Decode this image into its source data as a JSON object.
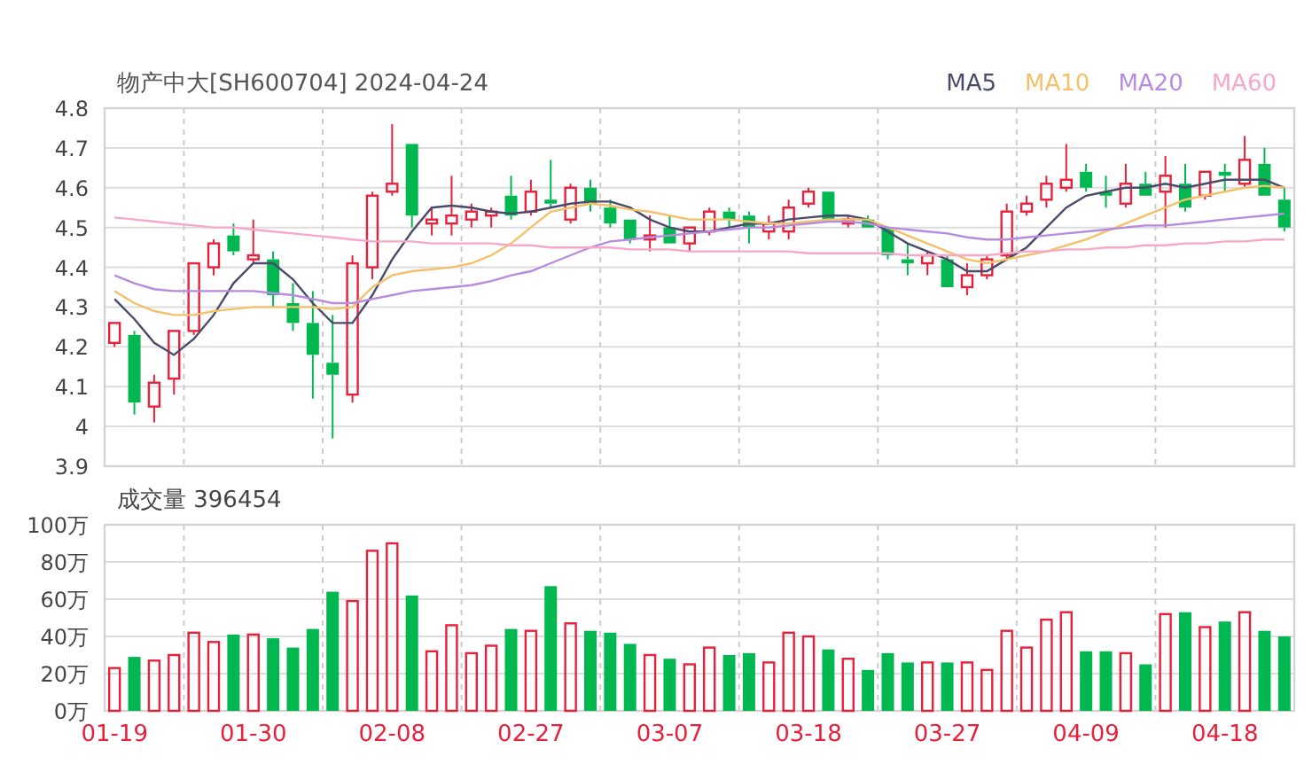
{
  "price_chart": {
    "candles": {
      "chart_data": {
        "type": "candlestick",
        "title": "物产中大[SH600704] 2024-04-24",
        "grid": true,
        "ylim": [
          3.9,
          4.8
        ],
        "yticks": [
          3.9,
          4,
          4.1,
          4.2,
          4.3,
          4.4,
          4.5,
          4.6,
          4.7,
          4.8
        ],
        "ohlc": [
          [
            4.21,
            4.26,
            4.2,
            4.26
          ],
          [
            4.23,
            4.24,
            4.03,
            4.06
          ],
          [
            4.05,
            4.13,
            4.01,
            4.11
          ],
          [
            4.12,
            4.24,
            4.08,
            4.24
          ],
          [
            4.24,
            4.41,
            4.23,
            4.41
          ],
          [
            4.4,
            4.47,
            4.38,
            4.46
          ],
          [
            4.48,
            4.51,
            4.43,
            4.44
          ],
          [
            4.42,
            4.52,
            4.41,
            4.43
          ],
          [
            4.42,
            4.44,
            4.3,
            4.33
          ],
          [
            4.31,
            4.36,
            4.24,
            4.26
          ],
          [
            4.26,
            4.34,
            4.07,
            4.18
          ],
          [
            4.16,
            4.28,
            3.97,
            4.13
          ],
          [
            4.08,
            4.43,
            4.06,
            4.41
          ],
          [
            4.4,
            4.59,
            4.37,
            4.58
          ],
          [
            4.59,
            4.76,
            4.58,
            4.61
          ],
          [
            4.71,
            4.71,
            4.5,
            4.53
          ],
          [
            4.51,
            4.55,
            4.48,
            4.52
          ],
          [
            4.51,
            4.63,
            4.48,
            4.53
          ],
          [
            4.52,
            4.56,
            4.5,
            4.54
          ],
          [
            4.53,
            4.55,
            4.5,
            4.54
          ],
          [
            4.58,
            4.63,
            4.52,
            4.53
          ],
          [
            4.54,
            4.62,
            4.53,
            4.59
          ],
          [
            4.57,
            4.67,
            4.55,
            4.56
          ],
          [
            4.52,
            4.61,
            4.51,
            4.6
          ],
          [
            4.6,
            4.62,
            4.54,
            4.56
          ],
          [
            4.55,
            4.57,
            4.5,
            4.51
          ],
          [
            4.52,
            4.52,
            4.46,
            4.47
          ],
          [
            4.47,
            4.53,
            4.44,
            4.48
          ],
          [
            4.5,
            4.53,
            4.46,
            4.46
          ],
          [
            4.46,
            4.5,
            4.44,
            4.5
          ],
          [
            4.49,
            4.55,
            4.48,
            4.54
          ],
          [
            4.54,
            4.55,
            4.5,
            4.52
          ],
          [
            4.53,
            4.54,
            4.46,
            4.5
          ],
          [
            4.49,
            4.53,
            4.47,
            4.51
          ],
          [
            4.49,
            4.57,
            4.47,
            4.55
          ],
          [
            4.56,
            4.6,
            4.55,
            4.59
          ],
          [
            4.59,
            4.59,
            4.52,
            4.52
          ],
          [
            4.51,
            4.53,
            4.5,
            4.52
          ],
          [
            4.52,
            4.53,
            4.5,
            4.5
          ],
          [
            4.5,
            4.5,
            4.42,
            4.43
          ],
          [
            4.42,
            4.46,
            4.38,
            4.41
          ],
          [
            4.41,
            4.44,
            4.38,
            4.43
          ],
          [
            4.42,
            4.43,
            4.35,
            4.35
          ],
          [
            4.35,
            4.41,
            4.33,
            4.38
          ],
          [
            4.38,
            4.43,
            4.37,
            4.42
          ],
          [
            4.43,
            4.56,
            4.42,
            4.54
          ],
          [
            4.54,
            4.58,
            4.53,
            4.56
          ],
          [
            4.57,
            4.63,
            4.55,
            4.61
          ],
          [
            4.6,
            4.71,
            4.59,
            4.62
          ],
          [
            4.64,
            4.66,
            4.59,
            4.6
          ],
          [
            4.59,
            4.63,
            4.55,
            4.58
          ],
          [
            4.56,
            4.66,
            4.55,
            4.61
          ],
          [
            4.61,
            4.64,
            4.58,
            4.58
          ],
          [
            4.59,
            4.68,
            4.5,
            4.63
          ],
          [
            4.61,
            4.66,
            4.54,
            4.55
          ],
          [
            4.58,
            4.64,
            4.57,
            4.64
          ],
          [
            4.64,
            4.66,
            4.59,
            4.63
          ],
          [
            4.61,
            4.73,
            4.6,
            4.67
          ],
          [
            4.66,
            4.7,
            4.58,
            4.58
          ],
          [
            4.57,
            4.6,
            4.49,
            4.5
          ]
        ]
      }
    },
    "moving_averages": {
      "chart_data": {
        "type": "line",
        "ylim": [
          3.9,
          4.8
        ],
        "series": [
          {
            "name": "MA5",
            "color": "#4a4a6a",
            "values": [
              4.32,
              4.27,
              4.21,
              4.18,
              4.22,
              4.28,
              4.36,
              4.41,
              4.41,
              4.37,
              4.31,
              4.26,
              4.26,
              4.33,
              4.42,
              4.49,
              4.55,
              4.555,
              4.55,
              4.54,
              4.535,
              4.54,
              4.55,
              4.56,
              4.565,
              4.565,
              4.55,
              4.52,
              4.5,
              4.49,
              4.49,
              4.5,
              4.51,
              4.51,
              4.52,
              4.525,
              4.53,
              4.53,
              4.52,
              4.49,
              4.46,
              4.44,
              4.42,
              4.39,
              4.39,
              4.42,
              4.45,
              4.5,
              4.55,
              4.58,
              4.59,
              4.6,
              4.6,
              4.61,
              4.6,
              4.61,
              4.62,
              4.62,
              4.62,
              4.6
            ]
          },
          {
            "name": "MA10",
            "color": "#f5c06a",
            "values": [
              4.34,
              4.31,
              4.29,
              4.28,
              4.28,
              4.29,
              4.295,
              4.3,
              4.3,
              4.3,
              4.3,
              4.295,
              4.3,
              4.35,
              4.38,
              4.39,
              4.395,
              4.4,
              4.41,
              4.43,
              4.46,
              4.5,
              4.54,
              4.55,
              4.56,
              4.555,
              4.545,
              4.54,
              4.53,
              4.52,
              4.52,
              4.52,
              4.515,
              4.51,
              4.51,
              4.515,
              4.52,
              4.52,
              4.52,
              4.5,
              4.48,
              4.46,
              4.44,
              4.42,
              4.41,
              4.42,
              4.43,
              4.44,
              4.455,
              4.47,
              4.49,
              4.51,
              4.53,
              4.55,
              4.57,
              4.58,
              4.59,
              4.6,
              4.605,
              4.6
            ]
          },
          {
            "name": "MA20",
            "color": "#b88be0",
            "values": [
              4.38,
              4.36,
              4.345,
              4.34,
              4.34,
              4.34,
              4.34,
              4.34,
              4.335,
              4.33,
              4.32,
              4.31,
              4.31,
              4.32,
              4.33,
              4.34,
              4.345,
              4.35,
              4.355,
              4.365,
              4.38,
              4.39,
              4.41,
              4.43,
              4.45,
              4.465,
              4.47,
              4.475,
              4.48,
              4.485,
              4.49,
              4.495,
              4.5,
              4.5,
              4.505,
              4.51,
              4.515,
              4.515,
              4.51,
              4.5,
              4.495,
              4.49,
              4.485,
              4.475,
              4.47,
              4.47,
              4.475,
              4.48,
              4.485,
              4.49,
              4.495,
              4.5,
              4.505,
              4.505,
              4.51,
              4.515,
              4.52,
              4.525,
              4.53,
              4.535
            ]
          },
          {
            "name": "MA60",
            "color": "#f7a8c8",
            "values": [
              4.525,
              4.52,
              4.515,
              4.51,
              4.505,
              4.5,
              4.5,
              4.495,
              4.49,
              4.485,
              4.48,
              4.475,
              4.47,
              4.465,
              4.465,
              4.465,
              4.46,
              4.46,
              4.46,
              4.46,
              4.455,
              4.455,
              4.45,
              4.45,
              4.45,
              4.45,
              4.445,
              4.445,
              4.445,
              4.44,
              4.44,
              4.44,
              4.44,
              4.44,
              4.44,
              4.435,
              4.435,
              4.435,
              4.435,
              4.435,
              4.43,
              4.43,
              4.43,
              4.43,
              4.43,
              4.435,
              4.44,
              4.44,
              4.445,
              4.445,
              4.45,
              4.45,
              4.455,
              4.455,
              4.46,
              4.46,
              4.465,
              4.465,
              4.47,
              4.47
            ]
          }
        ]
      }
    }
  },
  "volume_chart": {
    "chart_data": {
      "type": "bar",
      "title": "成交量 396454",
      "grid": true,
      "stacked": true,
      "ylim": [
        0,
        100
      ],
      "categories": [
        "01-19",
        null,
        null,
        null,
        null,
        null,
        null,
        "01-30",
        null,
        null,
        null,
        null,
        null,
        null,
        "02-08",
        null,
        null,
        null,
        null,
        null,
        null,
        "02-27",
        null,
        null,
        null,
        null,
        null,
        null,
        "03-07",
        null,
        null,
        null,
        null,
        null,
        null,
        "03-18",
        null,
        null,
        null,
        null,
        null,
        null,
        "03-27",
        null,
        null,
        null,
        null,
        null,
        null,
        "04-09",
        null,
        null,
        null,
        null,
        null,
        null,
        "04-18",
        null,
        null,
        null
      ],
      "yticks": [
        {
          "value": 0,
          "label": "0万"
        },
        {
          "value": 20,
          "label": "20万"
        },
        {
          "value": 40,
          "label": "40万"
        },
        {
          "value": 60,
          "label": "60万"
        },
        {
          "value": 80,
          "label": "80万"
        },
        {
          "value": 100,
          "label": "100万"
        }
      ],
      "series": [
        {
          "color": "#e8203a",
          "values": [
            23,
            null,
            27,
            30,
            42,
            37,
            null,
            41,
            null,
            null,
            null,
            null,
            59,
            86,
            90,
            null,
            32,
            46,
            31,
            35,
            null,
            43,
            null,
            47,
            null,
            null,
            null,
            30,
            null,
            25,
            34,
            null,
            null,
            26,
            42,
            40,
            null,
            28,
            null,
            null,
            null,
            26,
            null,
            26,
            22,
            43,
            34,
            49,
            53,
            null,
            null,
            31,
            null,
            52,
            null,
            45,
            null,
            53,
            null,
            null
          ]
        },
        {
          "color": "#00b84f",
          "values": [
            null,
            29,
            null,
            null,
            null,
            null,
            41,
            null,
            39,
            34,
            44,
            64,
            null,
            null,
            null,
            62,
            null,
            null,
            null,
            null,
            44,
            null,
            67,
            null,
            43,
            42,
            36,
            null,
            28,
            null,
            null,
            30,
            31,
            null,
            null,
            null,
            33,
            null,
            22,
            31,
            26,
            null,
            26,
            null,
            null,
            null,
            null,
            null,
            null,
            32,
            32,
            null,
            25,
            null,
            53,
            null,
            48,
            null,
            43,
            40
          ]
        }
      ]
    }
  }
}
